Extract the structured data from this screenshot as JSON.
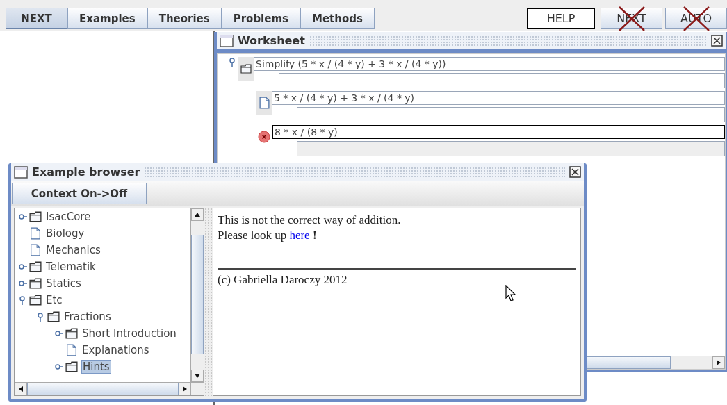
{
  "toolbar": {
    "tabs": [
      {
        "label": "NEXT",
        "selected": true
      },
      {
        "label": "Examples",
        "selected": false
      },
      {
        "label": "Theories",
        "selected": false
      },
      {
        "label": "Problems",
        "selected": false
      },
      {
        "label": "Methods",
        "selected": false
      }
    ],
    "actions": [
      {
        "label": "HELP",
        "disabled": false
      },
      {
        "label": "NEXT",
        "disabled": true
      },
      {
        "label": "AUTO",
        "disabled": true
      }
    ]
  },
  "worksheet": {
    "title": "Worksheet",
    "steps": [
      {
        "kind": "problem",
        "formula": "Simplify (5 * x / (4 * y) + 3 * x / (4 * y))",
        "expanded": true,
        "focused": false,
        "children": [
          {
            "kind": "step",
            "formula": "5 * x / (4 * y) + 3 * x / (4 * y)",
            "focused": false
          },
          {
            "kind": "error",
            "formula": "8 * x  /  (8 * y)",
            "focused": true
          }
        ]
      }
    ]
  },
  "example_browser": {
    "title": "Example browser",
    "context_button": "Context On->Off",
    "tree": [
      {
        "kind": "folder",
        "label": "IsacCore",
        "expanded": false,
        "selected": false
      },
      {
        "kind": "doc",
        "label": "Biology",
        "selected": false
      },
      {
        "kind": "doc",
        "label": "Mechanics",
        "selected": false
      },
      {
        "kind": "folder",
        "label": "Telematik",
        "expanded": false,
        "selected": false
      },
      {
        "kind": "folder",
        "label": "Statics",
        "expanded": false,
        "selected": false
      },
      {
        "kind": "folder",
        "label": "Etc",
        "expanded": true,
        "selected": false,
        "children": [
          {
            "kind": "folder",
            "label": "Fractions",
            "expanded": true,
            "selected": false,
            "children": [
              {
                "kind": "folder",
                "label": "Short Introduction",
                "expanded": false,
                "selected": false
              },
              {
                "kind": "doc",
                "label": "Explanations",
                "selected": false
              },
              {
                "kind": "folder",
                "label": "Hints",
                "expanded": false,
                "selected": true
              }
            ]
          }
        ]
      }
    ],
    "message": "This is not the correct way of addition.",
    "lookup_text": "Please look up",
    "link": "here",
    "lookup_end": "!",
    "footer": "(c)  Gabriella Daroczy 2012"
  }
}
